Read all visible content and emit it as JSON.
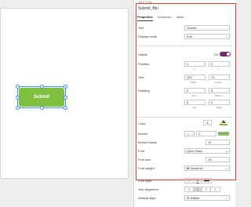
{
  "panel": {
    "section_label": "BUTTON",
    "title": "Submit_Btn",
    "tabs": [
      "Properties",
      "Advanced",
      "Ideas"
    ]
  },
  "canvas": {
    "button_text": "Submit"
  },
  "props": {
    "text_label": "Text",
    "text_value": "Submit",
    "display_label": "Display mode",
    "display_value": "Edit",
    "visible_label": "Visible",
    "visible_state": "On",
    "position_label": "Position",
    "pos_x": "0",
    "pos_y": "0",
    "x_sub": "X",
    "y_sub": "Y",
    "size_label": "Size",
    "size_w": "200",
    "size_h": "70",
    "width_sub": "Width",
    "height_sub": "Height",
    "padding_label": "Padding",
    "pad_top": "5",
    "pad_bottom": "5",
    "top_sub": "Top",
    "bottom_sub": "Bottom",
    "pad_left": "5",
    "pad_right": "5",
    "left_sub": "Left",
    "right_sub": "Right",
    "color_label": "Color",
    "color_btn": "A",
    "border_label": "Border",
    "border_width": "2",
    "radius_label": "Border radius",
    "radius_value": "10",
    "font_label": "Font",
    "font_value": "Open Sans",
    "fontsize_label": "Font size",
    "fontsize_value": "15",
    "fontweight_label": "Font weight",
    "fontweight_value": "Semibold",
    "fontstyle_label": "Font style",
    "style_italic": "/",
    "style_underline": "U",
    "style_strike": "abc",
    "align_label": "Text alignment",
    "valign_label": "Vertical align",
    "valign_value": "Middle"
  },
  "colors": {
    "accent": "#742774",
    "button": "#80c040",
    "highlight": "#e03c3c",
    "selection": "#3e8ede"
  }
}
